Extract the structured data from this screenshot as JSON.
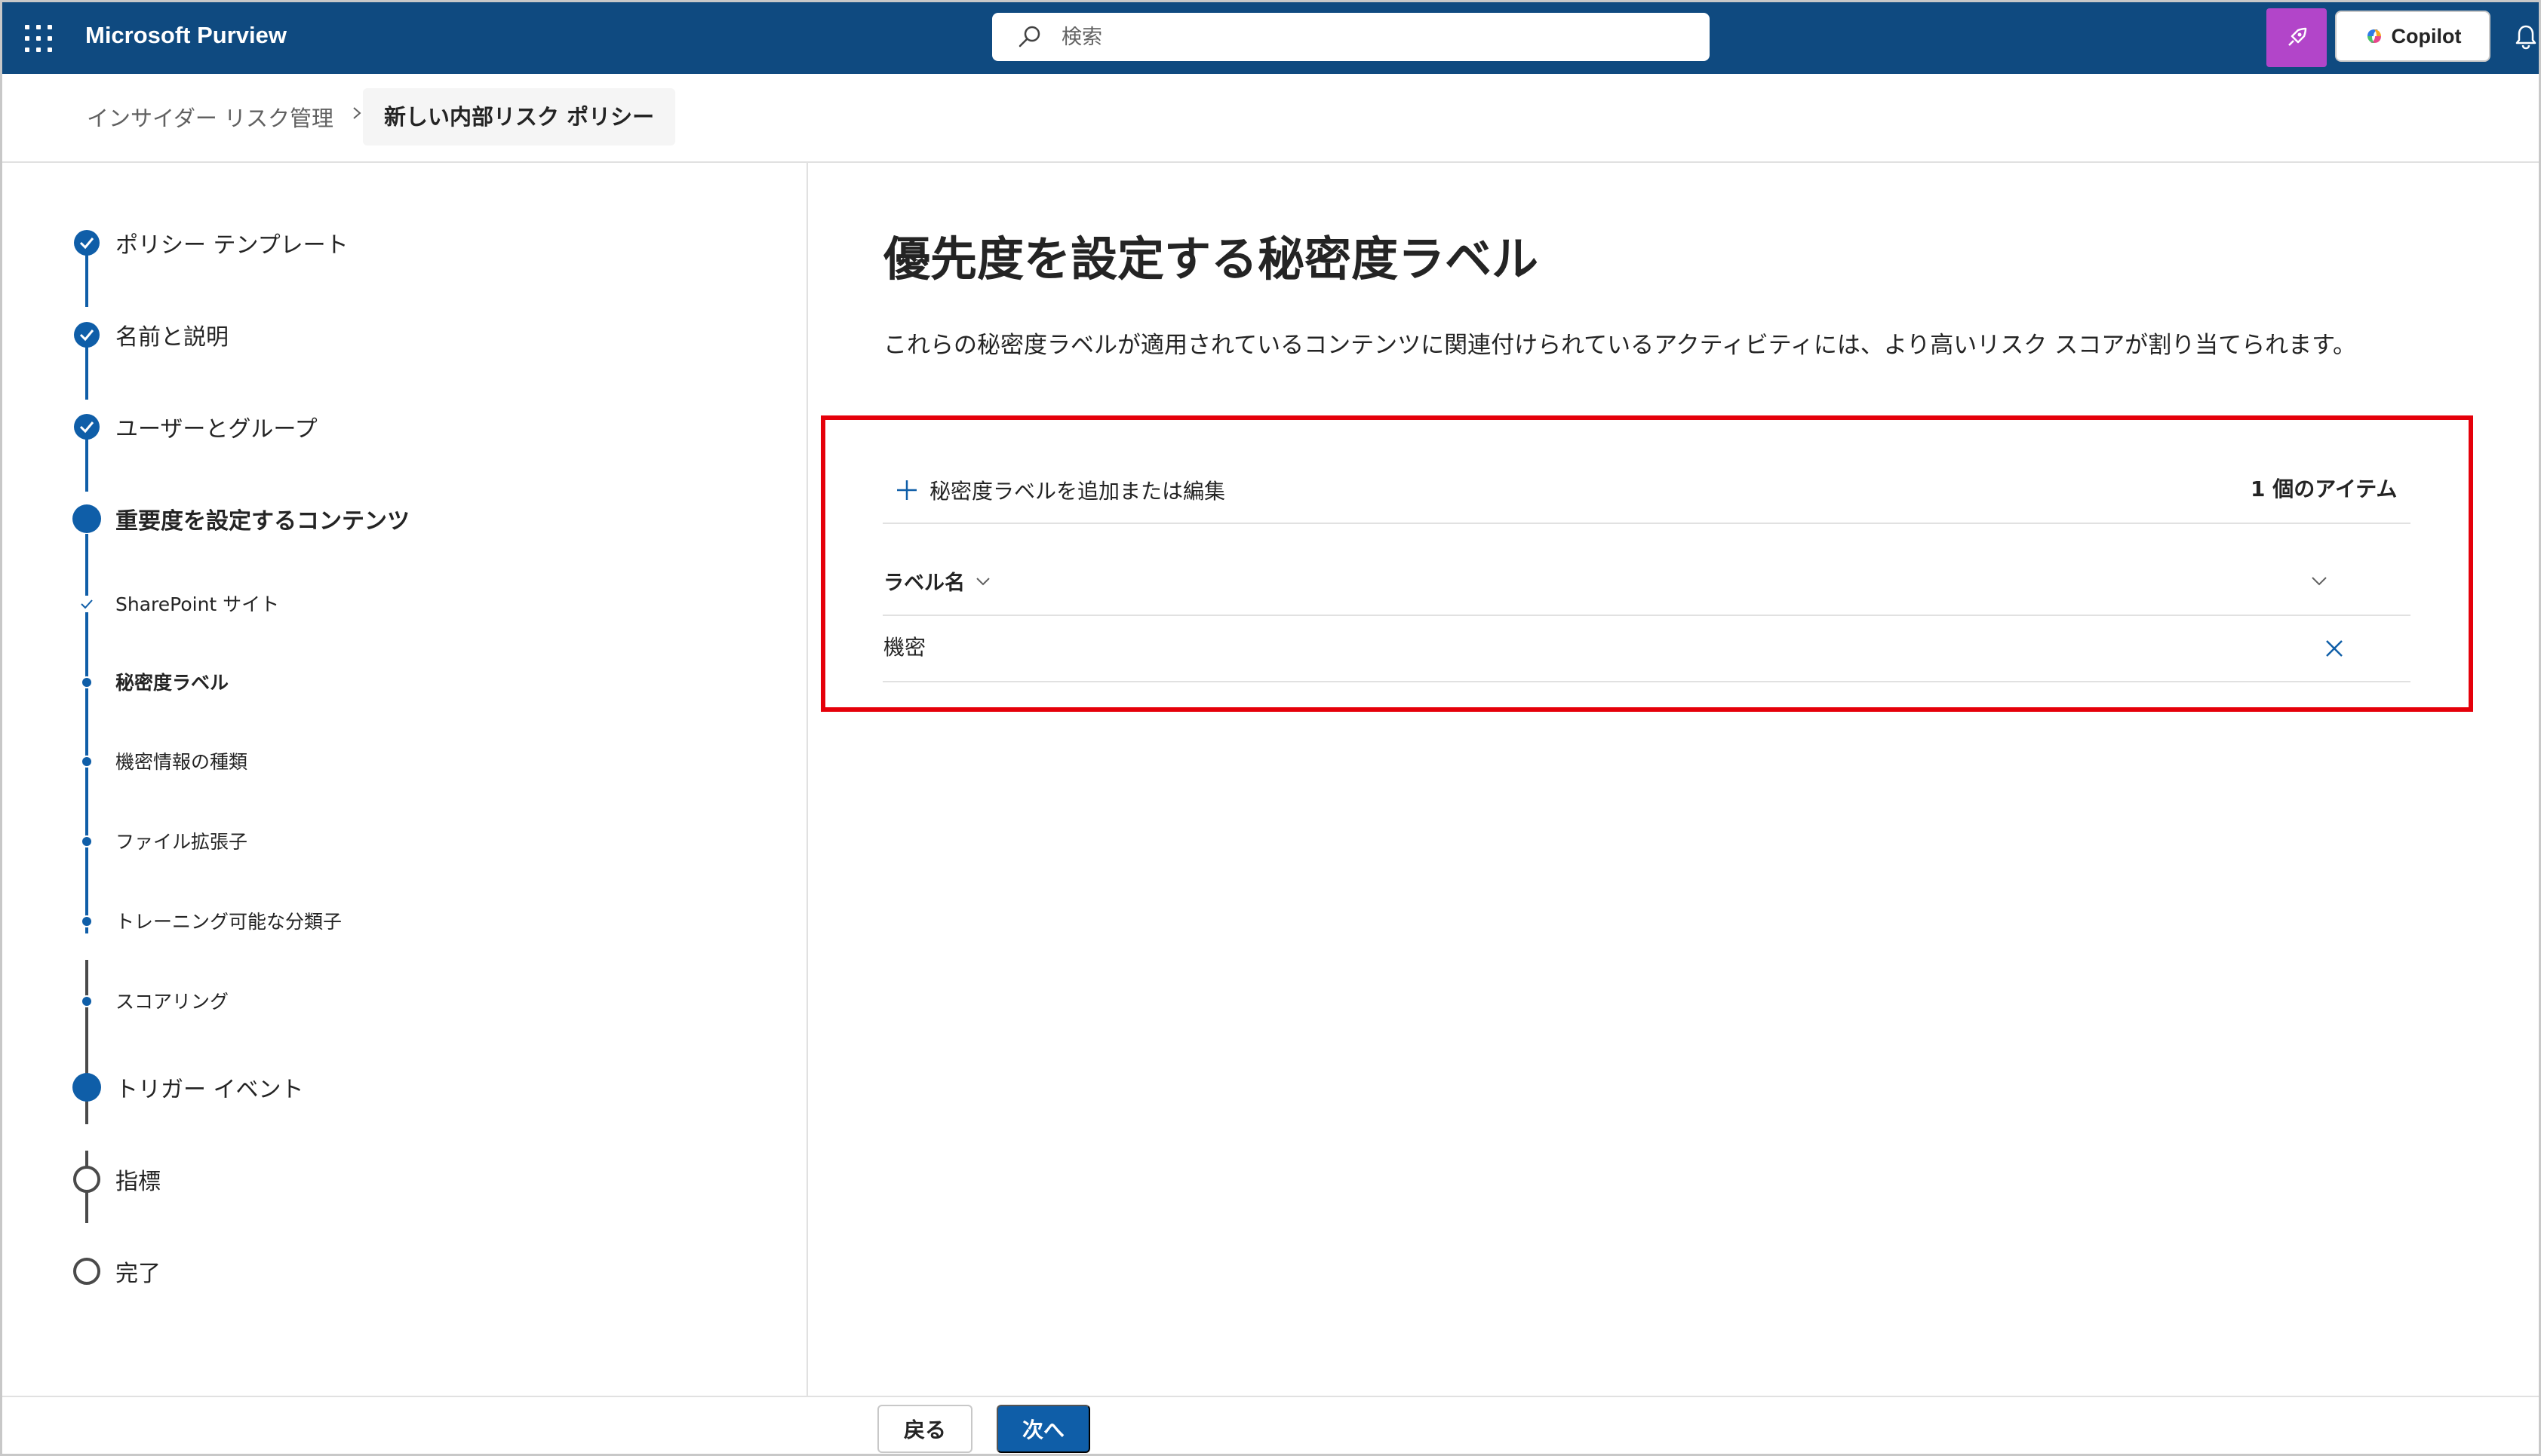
{
  "topbar": {
    "app_title": "Microsoft Purview",
    "search_placeholder": "検索",
    "copilot_label": "Copilot",
    "brand_color": "#0f4a80",
    "accent_button_color": "#b245c9"
  },
  "breadcrumb": {
    "items": [
      "インサイダー リスク管理",
      "新しい内部リスク ポリシー"
    ]
  },
  "wizard": {
    "steps": [
      {
        "label": "ポリシー テンプレート",
        "level": "major",
        "state": "completed"
      },
      {
        "label": "名前と説明",
        "level": "major",
        "state": "completed"
      },
      {
        "label": "ユーザーとグループ",
        "level": "major",
        "state": "completed"
      },
      {
        "label": "重要度を設定するコンテンツ",
        "level": "major",
        "state": "current"
      },
      {
        "label": "SharePoint サイト",
        "level": "minor",
        "state": "completed"
      },
      {
        "label": "秘密度ラベル",
        "level": "minor",
        "state": "current"
      },
      {
        "label": "機密情報の種類",
        "level": "minor",
        "state": "pending"
      },
      {
        "label": "ファイル拡張子",
        "level": "minor",
        "state": "pending"
      },
      {
        "label": "トレーニング可能な分類子",
        "level": "minor",
        "state": "pending"
      },
      {
        "label": "スコアリング",
        "level": "minor",
        "state": "pending"
      },
      {
        "label": "トリガー イベント",
        "level": "major",
        "state": "pending-filled"
      },
      {
        "label": "指標",
        "level": "major",
        "state": "not-started"
      },
      {
        "label": "完了",
        "level": "major",
        "state": "not-started"
      }
    ]
  },
  "main": {
    "title": "優先度を設定する秘密度ラベル",
    "description": "これらの秘密度ラベルが適用されているコンテンツに関連付けられているアクティビティには、より高いリスク スコアが割り当てられます。",
    "add_button_label": "秘密度ラベルを追加または編集",
    "item_count": "1 個のアイテム",
    "column_header": "ラベル名",
    "rows": [
      {
        "label": "機密"
      }
    ],
    "highlight_color": "#e5000a"
  },
  "footer": {
    "back_label": "戻る",
    "next_label": "次へ"
  }
}
